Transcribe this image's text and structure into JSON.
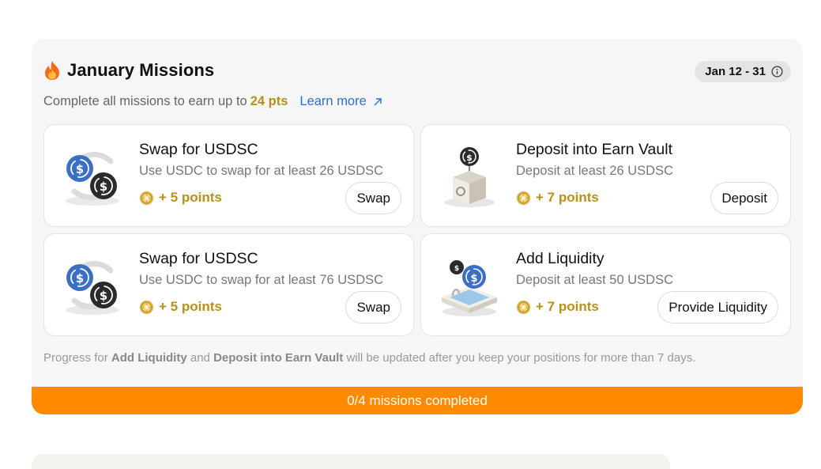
{
  "header": {
    "title": "January Missions",
    "date_range": "Jan 12 - 31",
    "subtitle_prefix": "Complete all missions to earn up to",
    "subtitle_points": "24 pts",
    "learn_more": "Learn more"
  },
  "missions": [
    {
      "title": "Swap for USDSC",
      "description": "Use USDC to swap for at least 26 USDSC",
      "points": "+ 5 points",
      "button": "Swap",
      "icon": "swap-usdc-usdsc-icon"
    },
    {
      "title": "Deposit into Earn Vault",
      "description": "Deposit at least 26 USDSC",
      "points": "+ 7 points",
      "button": "Deposit",
      "icon": "vault-icon"
    },
    {
      "title": "Swap for USDSC",
      "description": "Use USDC to swap for at least 76 USDSC",
      "points": "+ 5 points",
      "button": "Swap",
      "icon": "swap-usdc-usdsc-icon"
    },
    {
      "title": "Add Liquidity",
      "description": "Deposit at least 50 USDSC",
      "points": "+ 7 points",
      "button": "Provide Liquidity",
      "icon": "liquidity-pool-icon"
    }
  ],
  "footnote": {
    "prefix": "Progress for",
    "item1": "Add Liquidity",
    "and": "and",
    "item2": "Deposit into Earn Vault",
    "suffix": "will be updated after you keep your positions for more than 7 days."
  },
  "progress": {
    "text": "0/4 missions completed",
    "completed": 0,
    "total": 4
  },
  "colors": {
    "accent_orange": "#ff8a00",
    "points_gold": "#b8901c",
    "link_blue": "#2f6fd1",
    "usdc_blue": "#3b6fc4",
    "usdsc_dark": "#2b2b2b"
  }
}
